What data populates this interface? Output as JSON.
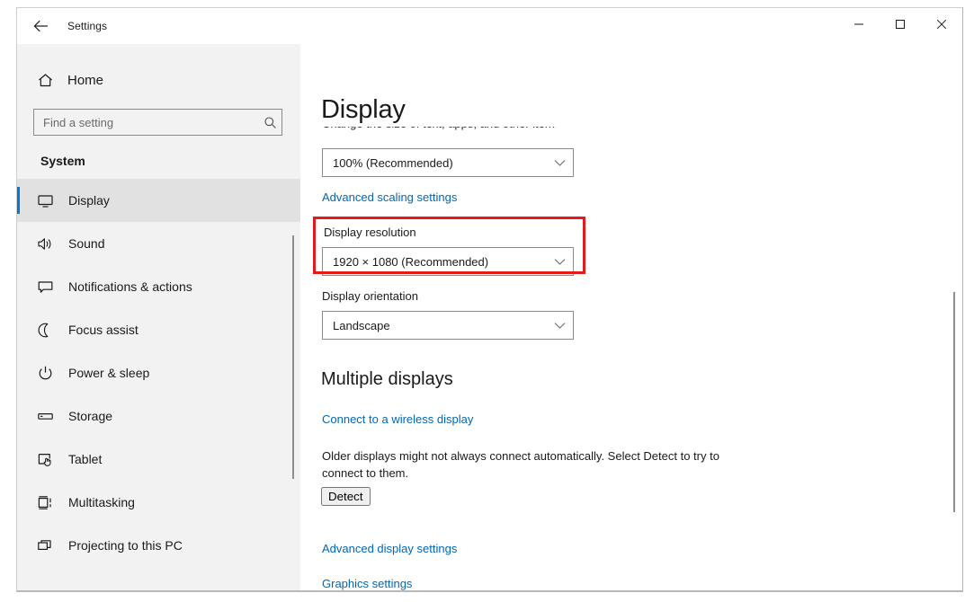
{
  "window": {
    "title": "Settings",
    "back_icon": "back-arrow-icon",
    "minimize_label": "—",
    "maximize_label": "□",
    "close_label": "✕"
  },
  "sidebar": {
    "home": {
      "label": "Home",
      "icon": "home-icon"
    },
    "search": {
      "placeholder": "Find a setting",
      "value": "",
      "icon": "search-icon"
    },
    "section_label": "System",
    "items": [
      {
        "label": "Display",
        "icon": "monitor-icon",
        "selected": true
      },
      {
        "label": "Sound",
        "icon": "speaker-icon",
        "selected": false
      },
      {
        "label": "Notifications & actions",
        "icon": "speech-bubble-icon",
        "selected": false
      },
      {
        "label": "Focus assist",
        "icon": "moon-icon",
        "selected": false
      },
      {
        "label": "Power & sleep",
        "icon": "power-icon",
        "selected": false
      },
      {
        "label": "Storage",
        "icon": "drive-icon",
        "selected": false
      },
      {
        "label": "Tablet",
        "icon": "tablet-hand-icon",
        "selected": false
      },
      {
        "label": "Multitasking",
        "icon": "multitasking-icon",
        "selected": false
      },
      {
        "label": "Projecting to this PC",
        "icon": "project-screen-icon",
        "selected": false
      }
    ]
  },
  "content": {
    "page_title": "Display",
    "clipped_remnant": "Change the size of text, apps, and other items",
    "scale": {
      "value": "100% (Recommended)",
      "chevron_icon": "chevron-down-icon"
    },
    "advanced_scaling_link": "Advanced scaling settings",
    "resolution": {
      "label": "Display resolution",
      "value": "1920 × 1080 (Recommended)",
      "chevron_icon": "chevron-down-icon"
    },
    "orientation": {
      "label": "Display orientation",
      "value": "Landscape",
      "chevron_icon": "chevron-down-icon"
    },
    "multiple_displays": {
      "heading": "Multiple displays",
      "wireless_link": "Connect to a wireless display",
      "description": "Older displays might not always connect automatically. Select Detect to try to connect to them.",
      "detect_button": "Detect"
    },
    "advanced_display_link": "Advanced display settings",
    "graphics_link": "Graphics settings"
  },
  "annotation": {
    "target": "Display resolution",
    "color": "#e01b1b"
  },
  "colors": {
    "accent": "#0078d4",
    "link": "#0067b8",
    "sidebar_bg": "#f2f2f2",
    "content_bg": "#ffffff",
    "annotation_red": "#e01b1b"
  }
}
